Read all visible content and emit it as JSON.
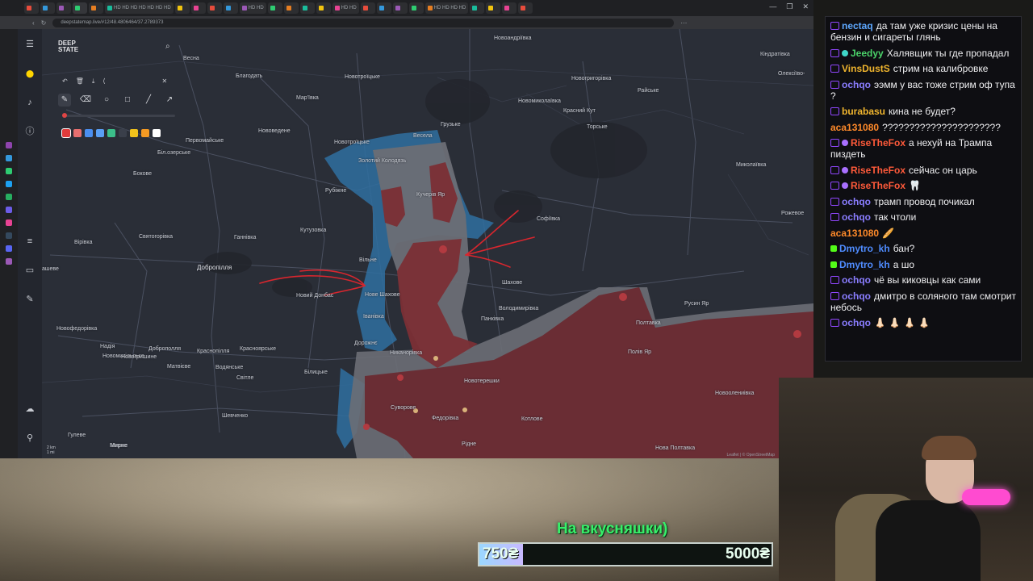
{
  "browser": {
    "tabs": [
      "",
      "",
      "",
      "",
      "",
      "HD HD HD HD HD HD HD",
      "",
      "",
      "",
      "",
      "HD HD",
      "",
      "",
      "",
      "",
      "HD HD",
      "",
      "",
      "",
      "",
      "HD HD HD HD",
      "",
      "",
      "",
      ""
    ],
    "url": "deepstatemap.live/#12/48.4806464/37.2789373",
    "window_controls": [
      "—",
      "❐",
      "✕"
    ]
  },
  "map_panel": {
    "logo_line1": "DEEP",
    "logo_line2": "STATE",
    "scale_km": "2 km",
    "scale_mi": "1 mi",
    "attribution": "Leaflet | © OpenStreetMap",
    "palette": [
      "#e03b3b",
      "#e86f6f",
      "#4b8ff0",
      "#5aa0f5",
      "#3bbf8a",
      "#3a3f4a",
      "#f2c31c",
      "#f59a23",
      "#ffffff"
    ]
  },
  "map_labels": [
    {
      "text": "Новоандріївка"
    },
    {
      "text": "Весна"
    },
    {
      "text": "Благодать"
    },
    {
      "text": "Новотроїцьке"
    },
    {
      "text": "Мар'ївка"
    },
    {
      "text": "Новомиколаївка"
    },
    {
      "text": "Новогригорівка"
    },
    {
      "text": "Райське"
    },
    {
      "text": "Олексіїво-"
    },
    {
      "text": "Кіндратівка"
    },
    {
      "text": "Нововедене"
    },
    {
      "text": "Грузьке"
    },
    {
      "text": "Красний Кут"
    },
    {
      "text": "Торське"
    },
    {
      "text": "Первомайське"
    },
    {
      "text": "Весела"
    },
    {
      "text": "Біл.озерське"
    },
    {
      "text": "Новотроїцьке"
    },
    {
      "text": "Бокове"
    },
    {
      "text": "Золотий Колодязь"
    },
    {
      "text": "Миколаївка"
    },
    {
      "text": "Рубіжне"
    },
    {
      "text": "Кучерів Яр"
    },
    {
      "text": "Рожевое"
    },
    {
      "text": "Софіївка"
    },
    {
      "text": "Вірівка"
    },
    {
      "text": "Святогорівка"
    },
    {
      "text": "Ганнівка"
    },
    {
      "text": "Кутузовка"
    },
    {
      "text": "Добропілля"
    },
    {
      "text": "Вільне"
    },
    {
      "text": "Шахове"
    },
    {
      "text": "Новий Донбас"
    },
    {
      "text": "Нове Шахове"
    },
    {
      "text": "Володимирівка"
    },
    {
      "text": "Русин Яр"
    },
    {
      "text": "Іванівка"
    },
    {
      "text": "Панківка"
    },
    {
      "text": "Полтавка"
    },
    {
      "text": "Новофедорівка"
    },
    {
      "text": "Надія"
    },
    {
      "text": "Доброполля"
    },
    {
      "text": "Краснопілля"
    },
    {
      "text": "Красноярське"
    },
    {
      "text": "Дорожнє"
    },
    {
      "text": "Мирне"
    },
    {
      "text": "Полів Яр"
    },
    {
      "text": "Новомикільське"
    },
    {
      "text": "Новогришине"
    },
    {
      "text": "Матвієве"
    },
    {
      "text": "Водянське"
    },
    {
      "text": "Світле"
    },
    {
      "text": "Білицьке"
    },
    {
      "text": "Никанорівка"
    },
    {
      "text": "Новотерешки"
    },
    {
      "text": "Суворове"
    },
    {
      "text": "Федорівка"
    },
    {
      "text": "Котлове"
    },
    {
      "text": "Новоолениівка"
    },
    {
      "text": "Шевченко"
    },
    {
      "text": "Гулеве"
    },
    {
      "text": "Мирне"
    },
    {
      "text": "Рідне"
    },
    {
      "text": "Нова Полтавка"
    },
    {
      "text": "ашеве"
    }
  ],
  "donation": {
    "title": "На вкусняшки)",
    "current": "750₴",
    "goal": "5000₴",
    "progress": 0.15
  },
  "chat": [
    {
      "user": "nectaq",
      "color": "#5ea8ff",
      "badge": "twitch",
      "text": "да там уже кризис цены на бензин и сигареты глянь"
    },
    {
      "user": "Jeedyy",
      "color": "#4bd36a",
      "badge": "twitch+snow",
      "text": "Халявщик ты где пропадал"
    },
    {
      "user": "VinsDustS",
      "color": "#f0b52e",
      "badge": "twitch",
      "text": "стрим на калибровке"
    },
    {
      "user": "ochqo",
      "color": "#8a7dff",
      "badge": "twitch",
      "text": "ээмм у вас тоже стрим оф тупа ?"
    },
    {
      "user": "burabasu",
      "color": "#f0b52e",
      "badge": "twitch",
      "text": "кина не будет?"
    },
    {
      "user": "aca131080",
      "color": "#ff8a2a",
      "badge": "",
      "text": "??????????????????????"
    },
    {
      "user": "RiseTheFox",
      "color": "#ff5a3a",
      "badge": "twitch+sub",
      "text": "а нехуй на Трампа пиздеть"
    },
    {
      "user": "RiseTheFox",
      "color": "#ff5a3a",
      "badge": "twitch+sub",
      "text": "сейчас он царь"
    },
    {
      "user": "RiseTheFox",
      "color": "#ff5a3a",
      "badge": "twitch+sub",
      "text": "🦷"
    },
    {
      "user": "ochqo",
      "color": "#8a7dff",
      "badge": "twitch",
      "text": "трамп провод почикал"
    },
    {
      "user": "ochqo",
      "color": "#8a7dff",
      "badge": "twitch",
      "text": "так чтоли"
    },
    {
      "user": "aca131080",
      "color": "#ff8a2a",
      "badge": "",
      "text": "🥖"
    },
    {
      "user": "Dmytro_kh",
      "color": "#4f8cff",
      "badge": "kick",
      "text": "бан?"
    },
    {
      "user": "Dmytro_kh",
      "color": "#4f8cff",
      "badge": "kick",
      "text": "а шо"
    },
    {
      "user": "ochqo",
      "color": "#8a7dff",
      "badge": "twitch",
      "text": "чё вы киковцы как сами"
    },
    {
      "user": "ochqo",
      "color": "#8a7dff",
      "badge": "twitch",
      "text": "дмитро в соляного там смотрит небось"
    },
    {
      "user": "ochqo",
      "color": "#8a7dff",
      "badge": "twitch",
      "text": "👃🏻 👃🏻 👃🏻 👃🏻"
    }
  ]
}
